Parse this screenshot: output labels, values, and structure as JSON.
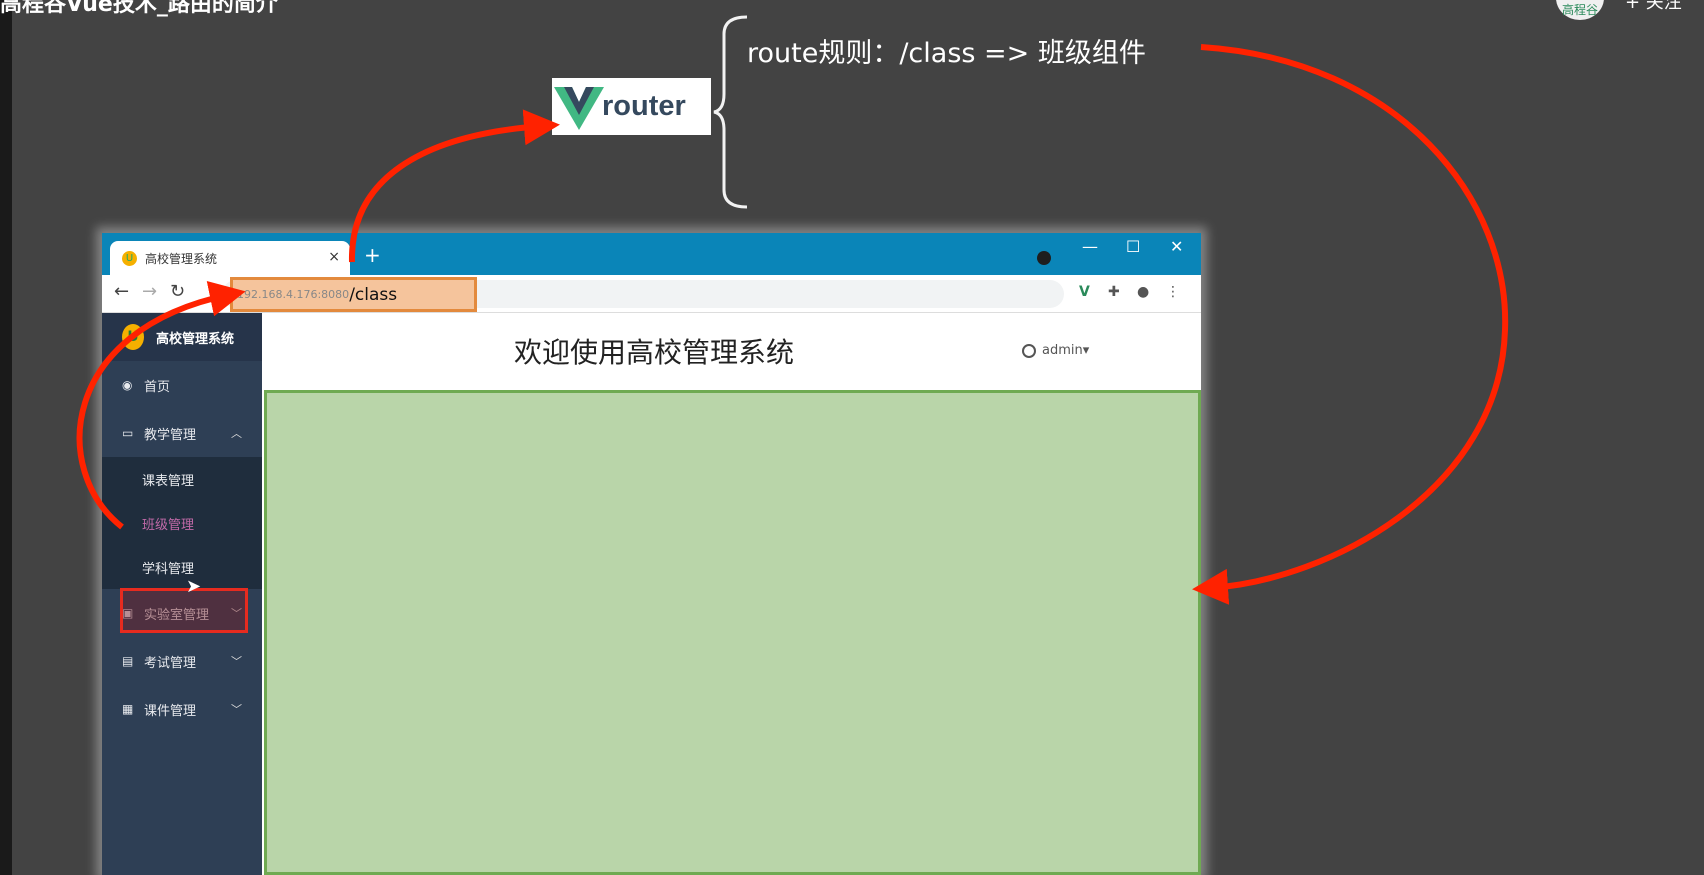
{
  "video": {
    "title": "高程谷Vue技术_路由的简介",
    "avatar_text": "高程谷",
    "follow_label": "+ 关注"
  },
  "diagram": {
    "logo_text": "router",
    "route_rule": "route规则：/class =>  班级组件"
  },
  "browser": {
    "tab_title": "高校管理系统",
    "tab_close": "×",
    "new_tab": "+",
    "minimize": "—",
    "maximize": "☐",
    "close": "✕",
    "url_host": "192.168.4.176:8080",
    "url_path": "/class"
  },
  "app": {
    "brand": "高校管理系统",
    "welcome": "欢迎使用高校管理系统",
    "user": "admin",
    "menu": {
      "home": "首页",
      "teaching": "教学管理",
      "teaching_sub": [
        "课表管理",
        "班级管理",
        "学科管理"
      ],
      "lab": "实验室管理",
      "exam": "考试管理",
      "course": "课件管理"
    }
  },
  "colors": {
    "background": "#434343",
    "sidebar": "#2e3f55",
    "tabstrip": "#0a85b8",
    "content": "#b9d5a9",
    "arrow": "#ff2200",
    "highlight": "#f5c49c"
  }
}
